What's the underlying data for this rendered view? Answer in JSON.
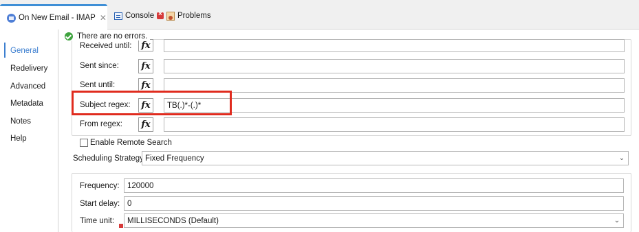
{
  "tabs": [
    {
      "label": "On New Email - IMAP",
      "icon": "mail-icon",
      "close": "✕"
    },
    {
      "label": "Console",
      "icon": "console-icon"
    },
    {
      "label": "Problems",
      "icon": "problems-icon"
    }
  ],
  "sidebar": {
    "items": [
      {
        "label": "General"
      },
      {
        "label": "Redelivery"
      },
      {
        "label": "Advanced"
      },
      {
        "label": "Metadata"
      },
      {
        "label": "Notes"
      },
      {
        "label": "Help"
      }
    ]
  },
  "status": {
    "text": "There are no errors.",
    "icon": "check-circle-icon"
  },
  "fields": [
    {
      "label": "Received until:",
      "value": ""
    },
    {
      "label": "Sent since:",
      "value": ""
    },
    {
      "label": "Sent until:",
      "value": ""
    },
    {
      "label": "Subject regex:",
      "value": "TB(.)*-(.)*"
    },
    {
      "label": "From regex:",
      "value": ""
    }
  ],
  "fx_label": "fx",
  "remote_search": {
    "label": "Enable Remote Search",
    "checked": false
  },
  "scheduling": {
    "label": "Scheduling Strategy",
    "value": "Fixed Frequency"
  },
  "schedule_fields": {
    "frequency": {
      "label": "Frequency:",
      "value": "120000"
    },
    "start_delay": {
      "label": "Start delay:",
      "value": "0"
    },
    "time_unit": {
      "label": "Time unit:",
      "value": "MILLISECONDS (Default)"
    }
  },
  "colors": {
    "accent": "#3d7fd0",
    "highlight": "#e02b1e",
    "ok": "#3fa33f"
  }
}
